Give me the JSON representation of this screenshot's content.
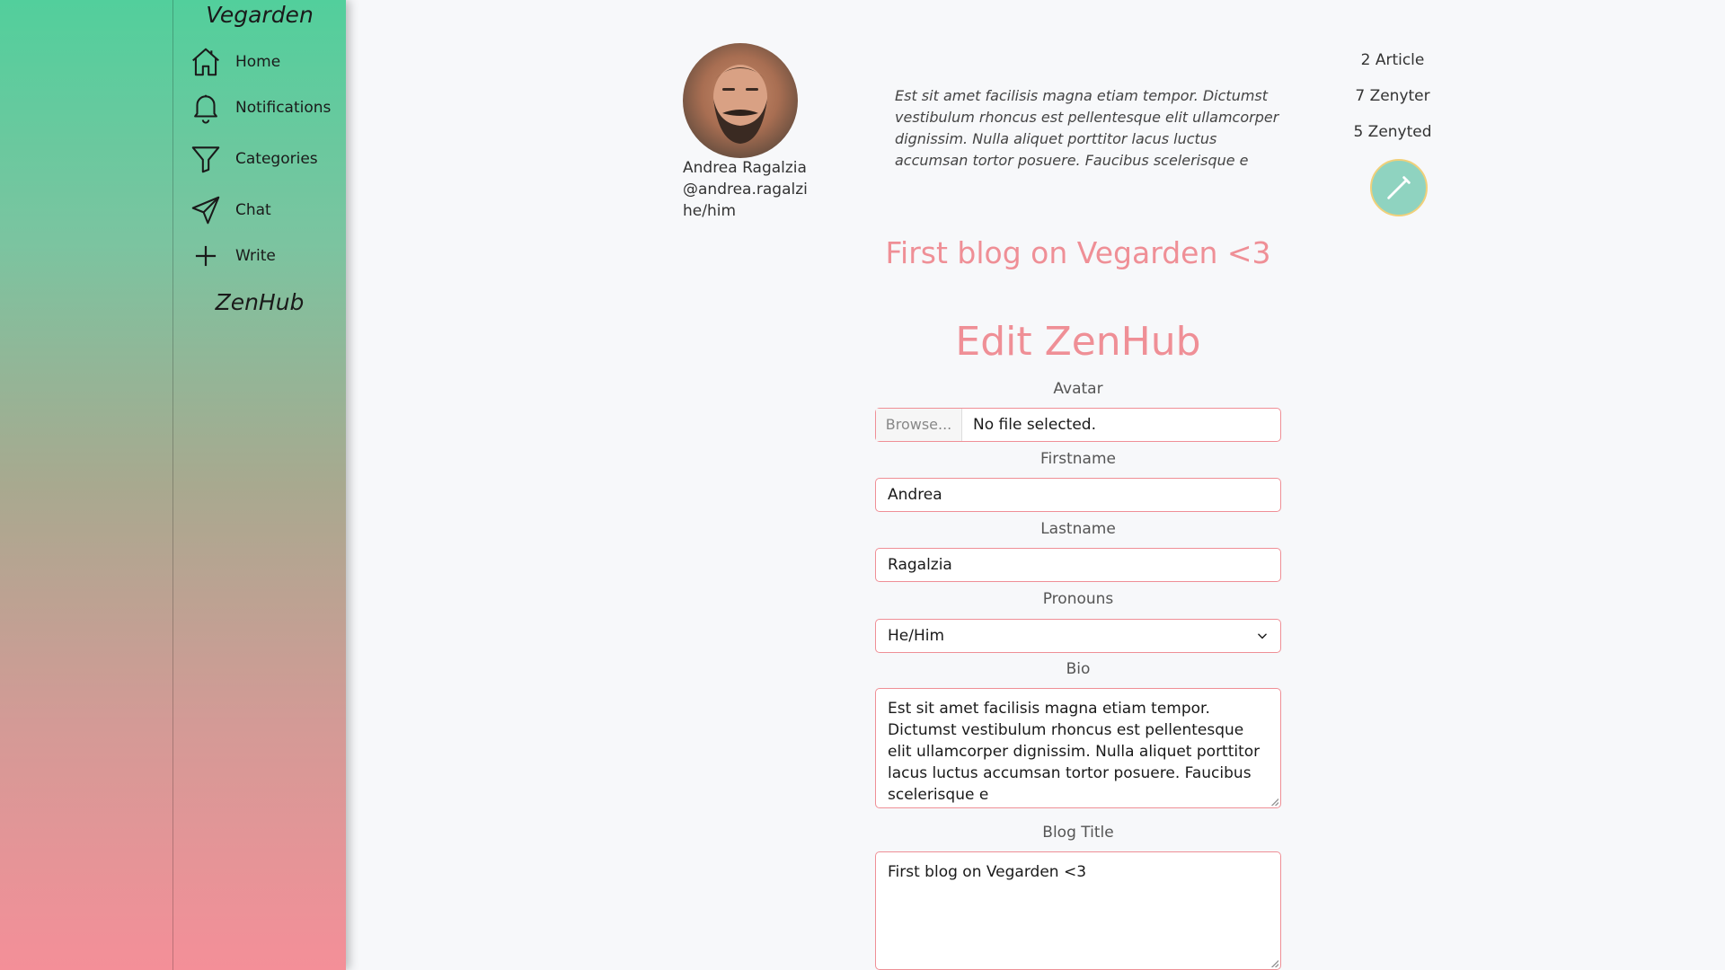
{
  "sidebar": {
    "brand": "Vegarden",
    "items": [
      {
        "label": "Home",
        "icon": "home-icon"
      },
      {
        "label": "Notifications",
        "icon": "bell-icon"
      },
      {
        "label": "Categories",
        "icon": "filter-icon"
      },
      {
        "label": "Chat",
        "icon": "send-icon"
      },
      {
        "label": "Write",
        "icon": "plus-icon"
      }
    ],
    "footer": "ZenHub"
  },
  "profile": {
    "name": "Andrea Ragalzia",
    "handle": "@andrea.ragalzi",
    "pronouns": "he/him",
    "bio": "Est sit amet facilisis magna etiam tempor. Dictumst vestibulum rhoncus est pellentesque elit ullamcorper dignissim. Nulla aliquet porttitor lacus luctus accumsan tortor posuere. Faucibus scelerisque e",
    "stats": [
      "2 Article",
      "7 Zenyter",
      "5 Zenyted"
    ],
    "blog_title": "First blog on Vegarden <3"
  },
  "form": {
    "heading": "Edit ZenHub",
    "avatar_label": "Avatar",
    "browse_label": "Browse...",
    "file_status": "No file selected.",
    "firstname_label": "Firstname",
    "firstname_value": "Andrea",
    "lastname_label": "Lastname",
    "lastname_value": "Ragalzia",
    "pronouns_label": "Pronouns",
    "pronouns_value": "He/Him",
    "bio_label": "Bio",
    "bio_value": "Est sit amet facilisis magna etiam tempor. Dictumst vestibulum rhoncus est pellentesque elit ullamcorper dignissim. Nulla aliquet porttitor lacus luctus accumsan tortor posuere. Faucibus scelerisque e",
    "blog_title_label": "Blog Title",
    "blog_title_value": "First blog on Vegarden <3"
  },
  "colors": {
    "accent": "#ef8f96",
    "sidebar_top": "#52cf9c",
    "sidebar_bottom": "#f48f98",
    "fab": "#8fd3c0"
  }
}
